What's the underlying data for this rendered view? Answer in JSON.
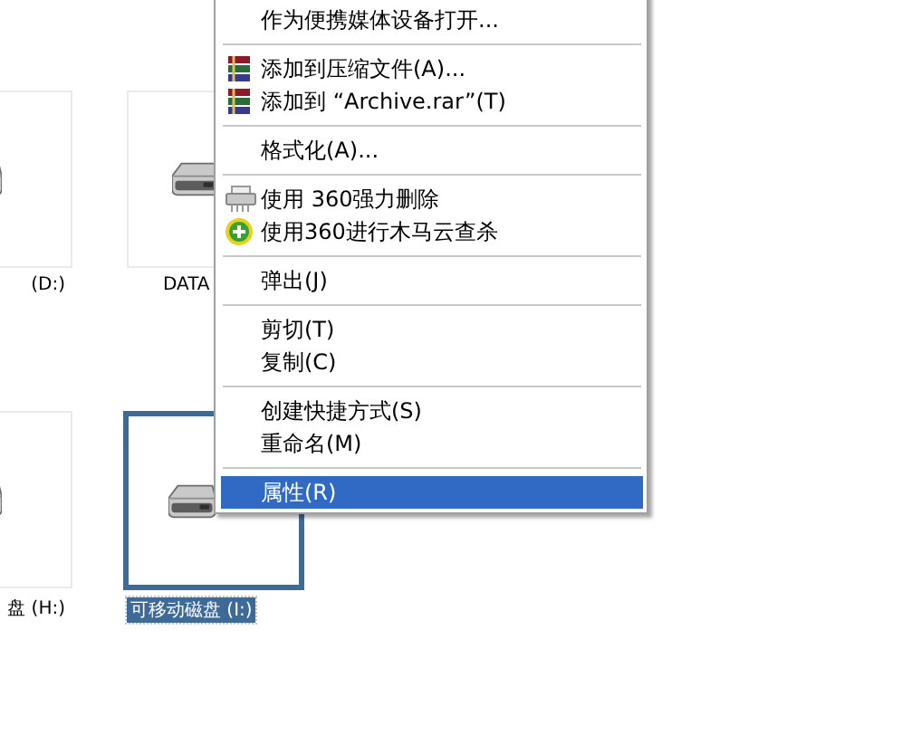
{
  "drives": [
    {
      "label": "(D:)",
      "selected": false
    },
    {
      "label": "DATA",
      "selected": false
    },
    {
      "label": "盘 (H:)",
      "selected": false
    },
    {
      "label": "可移动磁盘 (I:)",
      "selected": true
    }
  ],
  "context_menu": {
    "items": [
      {
        "kind": "plain",
        "text": "作为便携媒体设备打开...",
        "selected": false
      },
      {
        "kind": "separator"
      },
      {
        "kind": "archive",
        "text": "添加到压缩文件(A)...",
        "selected": false
      },
      {
        "kind": "archive",
        "text": "添加到 “Archive.rar”(T)",
        "selected": false
      },
      {
        "kind": "separator"
      },
      {
        "kind": "plain",
        "text": "格式化(A)...",
        "selected": false
      },
      {
        "kind": "separator"
      },
      {
        "kind": "shredder",
        "text": "使用 360强力删除",
        "selected": false
      },
      {
        "kind": "antivirus",
        "text": "使用360进行木马云查杀",
        "selected": false
      },
      {
        "kind": "separator"
      },
      {
        "kind": "plain",
        "text": "弹出(J)",
        "selected": false
      },
      {
        "kind": "separator"
      },
      {
        "kind": "plain",
        "text": "剪切(T)",
        "selected": false
      },
      {
        "kind": "plain",
        "text": "复制(C)",
        "selected": false
      },
      {
        "kind": "separator"
      },
      {
        "kind": "plain",
        "text": "创建快捷方式(S)",
        "selected": false
      },
      {
        "kind": "plain",
        "text": "重命名(M)",
        "selected": false
      },
      {
        "kind": "separator"
      },
      {
        "kind": "plain",
        "text": "属性(R)",
        "selected": true
      }
    ]
  }
}
